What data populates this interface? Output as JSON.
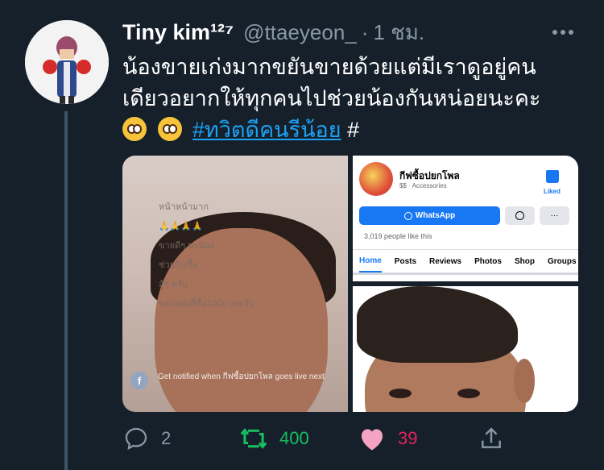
{
  "tweet": {
    "display_name": "Tiny kim¹²⁷",
    "username": "@ttaeyeon_",
    "separator": "·",
    "timestamp": "1 ชม.",
    "text_line1": "น้องขายเก่งมากขยันขายด้วยแต่มีเราดูอยู่คน",
    "text_line2": "เดียวอยากให้ทุกคนไปช่วยน้องกันหน่อยนะคะ",
    "hashtag": "#ทวิตดีคนรีน้อย",
    "trailing_hash": "#",
    "emoji": [
      "pleading-face",
      "pleading-face"
    ]
  },
  "media": {
    "live_notice": "Get notified when กีฟซื้อปยกโพล goes live next",
    "fb_badge": "f",
    "live_comments": [
      "หน้าหน้ามาก",
      "🙏🙏🙏🙏",
      "ขายดีๆ นะน้อง",
      "ช่วยกันซื้อ",
      "สู้ๆ ครับ",
      "ขอบคุณที่ซื้อ100บาทครับ"
    ],
    "page": {
      "name": "กีฟซื้อปยกโพล",
      "category": "$$ · Accessories",
      "liked_label": "Liked",
      "whatsapp_label": "WhatsApp",
      "more_label": "···",
      "likes_text": "3,019 people like this",
      "tabs": [
        "Home",
        "Posts",
        "Reviews",
        "Photos",
        "Shop",
        "Groups"
      ]
    }
  },
  "actions": {
    "reply_count": "2",
    "retweet_count": "400",
    "like_count": "39"
  },
  "colors": {
    "background": "#15202b",
    "secondary_text": "#8899a6",
    "link": "#1da1f2",
    "retweet": "#17bf63",
    "like": "#e0245e",
    "facebook_blue": "#1877f2"
  }
}
